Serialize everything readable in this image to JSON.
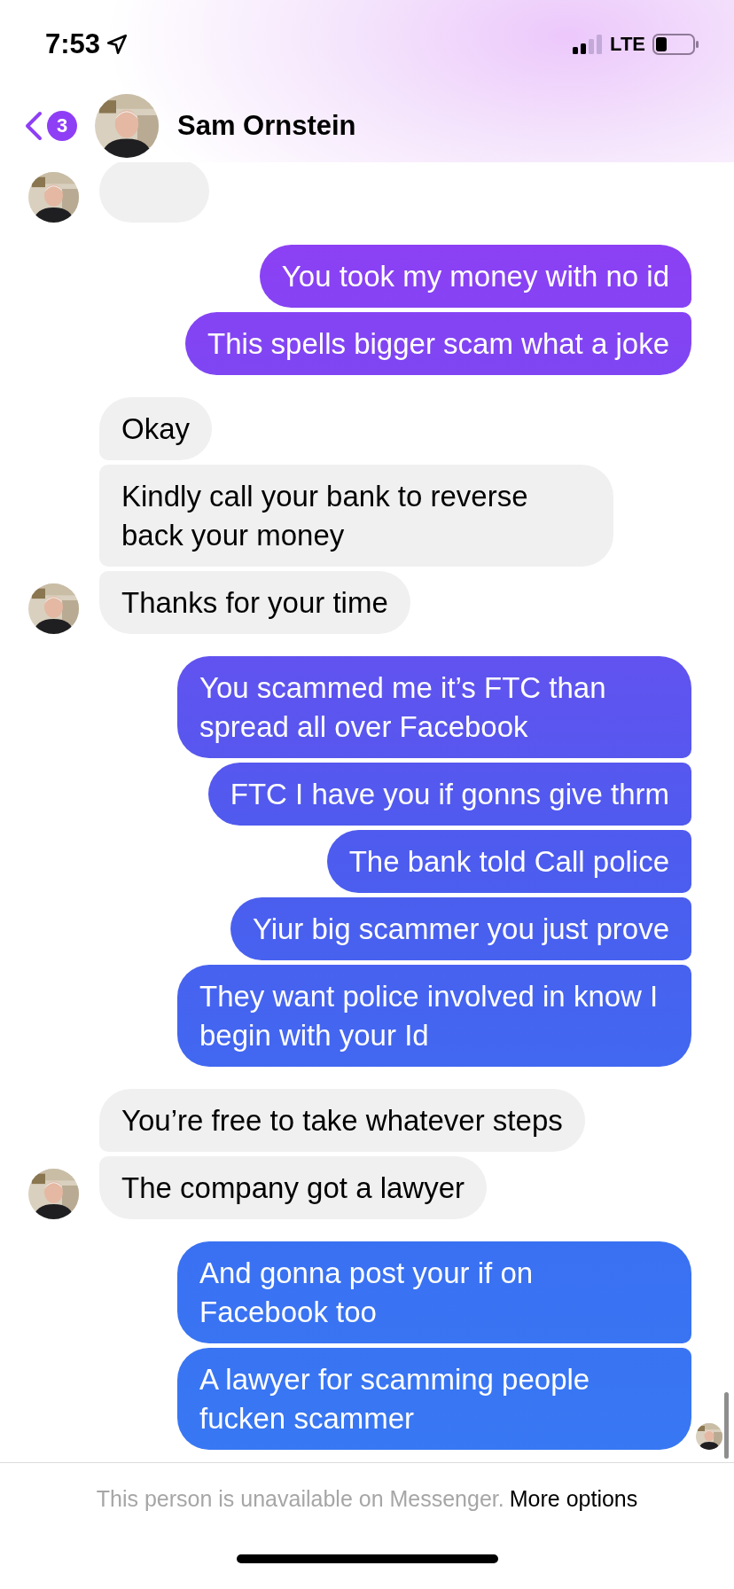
{
  "status_bar": {
    "time": "7:53",
    "network": "LTE"
  },
  "header": {
    "back_badge": "3",
    "contact_name": "Sam Ornstein"
  },
  "groups": [
    {
      "kind": "me",
      "messages": [
        "You took my money with no id",
        "This spells bigger scam what a joke"
      ]
    },
    {
      "kind": "them",
      "messages": [
        "Okay",
        "Kindly call your bank to reverse back your money",
        "Thanks for your time"
      ]
    },
    {
      "kind": "me",
      "messages": [
        "You scammed me it’s FTC than spread all over Facebook",
        "FTC I have you if gonns give thrm",
        "The bank told Call police",
        "Yiur big scammer you just prove",
        "They want police involved in know I begin with your Id"
      ]
    },
    {
      "kind": "them",
      "messages": [
        "You’re free to take whatever steps",
        "The company got a lawyer"
      ]
    },
    {
      "kind": "me",
      "seen": true,
      "messages": [
        "And gonna post your if on Facebook too",
        "A lawyer for scamming people fucken scammer"
      ]
    }
  ],
  "footer": {
    "notice": "This person is unavailable on Messenger.",
    "link": "More options"
  }
}
